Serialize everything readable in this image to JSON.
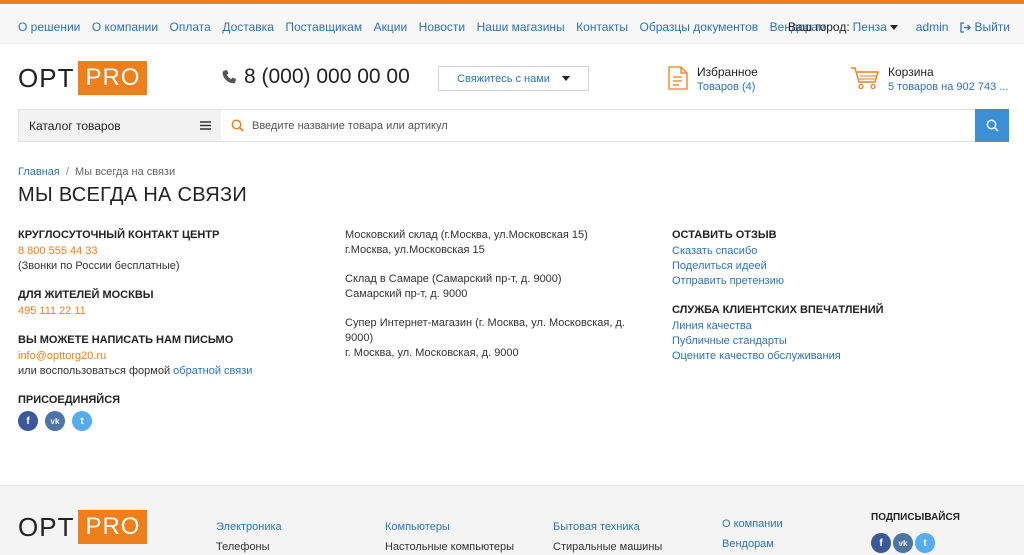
{
  "topnav": {
    "menu": [
      "О решении",
      "О компании",
      "Оплата",
      "Доставка",
      "Поставщикам",
      "Акции",
      "Новости",
      "Наши магазины",
      "Контакты",
      "Образцы документов",
      "Вендорам"
    ],
    "city_label": "Ваш город:",
    "city": "Пенза",
    "admin": "admin",
    "logout": "Выйти"
  },
  "logo": {
    "opt": "OPT",
    "pro": "PRO"
  },
  "header": {
    "phone": "8 (000) 000 00 00",
    "contact_button": "Свяжитесь с нами",
    "favorites_title": "Избранное",
    "favorites_count": "Товаров (4)",
    "cart_title": "Корзина",
    "cart_summary": "5 товаров на 902 743 ..."
  },
  "search": {
    "catalog_label": "Каталог товаров",
    "placeholder": "Введите название товара или артикул"
  },
  "breadcrumb": {
    "home": "Главная",
    "sep": "/",
    "current": "Мы всегда на связи"
  },
  "page_title": "МЫ ВСЕГДА НА СВЯЗИ",
  "contacts": {
    "center_title": "КРУГЛОСУТОЧНЫЙ КОНТАКТ ЦЕНТР",
    "center_phone": "8 800 555 44 33",
    "center_note": "(Звонки по России бесплатные)",
    "moscow_title": "ДЛЯ ЖИТЕЛЕЙ МОСКВЫ",
    "moscow_phone": "495 111 22 11",
    "letter_title": "ВЫ МОЖЕТЕ НАПИСАТЬ НАМ ПИСЬМО",
    "email": "info@opttorg20.ru",
    "form_prefix": "или воспользоваться формой",
    "form_link": "обратной связи",
    "join_title": "ПРИСОЕДИНЯЙСЯ"
  },
  "warehouses": [
    {
      "name": "Московский склад (г.Москва, ул.Московская 15)",
      "address": "г.Москва, ул.Московская 15"
    },
    {
      "name": "Склад в Самаре (Самарский пр-т, д. 9000)",
      "address": "Самарский пр-т, д. 9000"
    },
    {
      "name": "Супер Интернет-магазин (г. Москва, ул. Московская, д. 9000)",
      "address": "г. Москва, ул. Московская, д. 9000"
    }
  ],
  "feedback": {
    "title": "ОСТАВИТЬ ОТЗЫВ",
    "links": [
      "Сказать спасибо",
      "Поделиться идеей",
      "Отправить претензию"
    ],
    "service_title": "СЛУЖБА КЛИЕНТСКИХ ВПЕЧАТЛЕНИЙ",
    "service_links": [
      "Линия качества",
      "Публичные стандарты",
      "Оцените качество обслуживания"
    ]
  },
  "social": [
    {
      "name": "facebook-icon",
      "glyph": "f",
      "color": "#3b5998"
    },
    {
      "name": "vk-icon",
      "glyph": "vk",
      "color": "#4c75a3"
    },
    {
      "name": "twitter-icon",
      "glyph": "t",
      "color": "#55acee"
    }
  ],
  "footer": {
    "col1_title": "Электроника",
    "col1_sub": "Телефоны",
    "col2_title": "Компьютеры",
    "col2_sub": "Настольные компьютеры",
    "col3_title": "Бытовая техника",
    "col3_sub": "Стиральные машины",
    "col4_title": "О компании",
    "col4_sub": "Вендорам",
    "subscribe": "ПОДПИСЫВАЙСЯ"
  },
  "colors": {
    "accent": "#ef7f1a",
    "link": "#2e73b8",
    "search_button": "#3a8fd7"
  }
}
